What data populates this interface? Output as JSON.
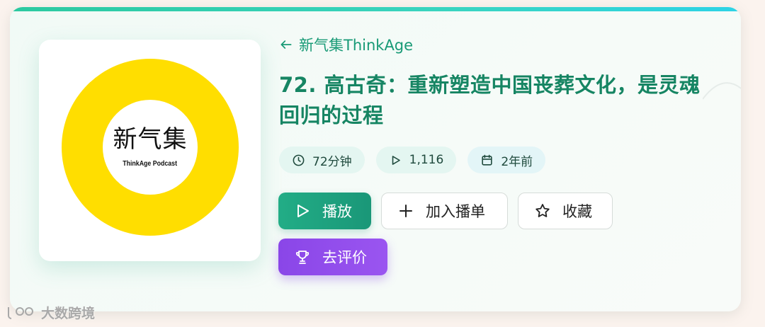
{
  "podcast": {
    "back_label": "新气集ThinkAge",
    "cover_title": "新气集",
    "cover_subtitle": "ThinkAge Podcast"
  },
  "episode": {
    "title": "72. 高古奇：重新塑造中国丧葬文化，是灵魂回归的过程"
  },
  "meta": {
    "duration": "72分钟",
    "plays": "1,116",
    "date": "2年前"
  },
  "actions": {
    "play_label": "播放",
    "add_to_list_label": "加入播单",
    "favorite_label": "收藏",
    "rate_label": "去评价"
  },
  "watermark": {
    "text": "大数跨境"
  },
  "colors": {
    "accent_green": "#168563",
    "play_button": "#1fa57f",
    "rate_button": "#9050ec",
    "cover_ring": "#ffde00"
  },
  "icons": {
    "back": "arrow-left-icon",
    "duration": "clock-icon",
    "plays": "play-icon",
    "date": "calendar-icon",
    "play_button": "play-icon",
    "add": "plus-icon",
    "favorite": "star-icon",
    "rate": "trophy-icon"
  }
}
